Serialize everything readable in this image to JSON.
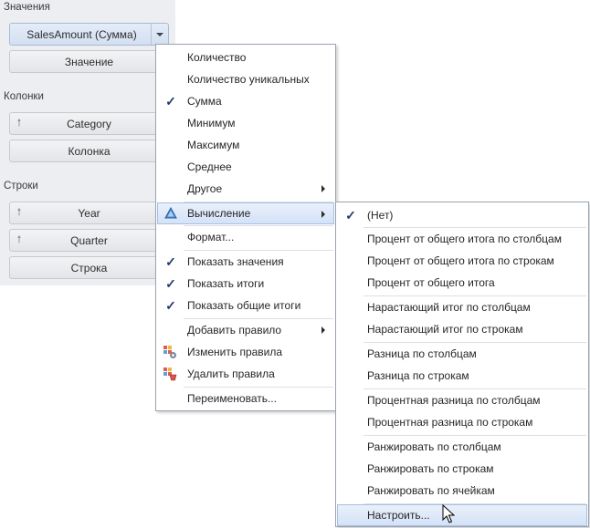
{
  "panel": {
    "values_label": "Значения",
    "values_field": "SalesAmount (Сумма)",
    "values_placeholder": "Значение",
    "columns_label": "Колонки",
    "columns_field": "Category",
    "columns_placeholder": "Колонка",
    "rows_label": "Строки",
    "rows_field_1": "Year",
    "rows_field_2": "Quarter",
    "rows_placeholder": "Строка"
  },
  "menu": {
    "items": [
      "Количество",
      "Количество уникальных",
      "Сумма",
      "Минимум",
      "Максимум",
      "Среднее",
      "Другое",
      "Вычисление",
      "Формат...",
      "Показать значения",
      "Показать итоги",
      "Показать общие итоги",
      "Добавить правило",
      "Изменить правила",
      "Удалить правила",
      "Переименовать..."
    ]
  },
  "submenu": {
    "items": [
      "(Нет)",
      "Процент от общего итога по столбцам",
      "Процент от общего итога по строкам",
      "Процент от общего итога",
      "Нарастающий итог по столбцам",
      "Нарастающий итог по строкам",
      "Разница по столбцам",
      "Разница по строкам",
      "Процентная разница по столбцам",
      "Процентная разница по строкам",
      "Ранжировать по столбцам",
      "Ранжировать по строкам",
      "Ранжировать по ячейкам",
      "Настроить..."
    ]
  }
}
